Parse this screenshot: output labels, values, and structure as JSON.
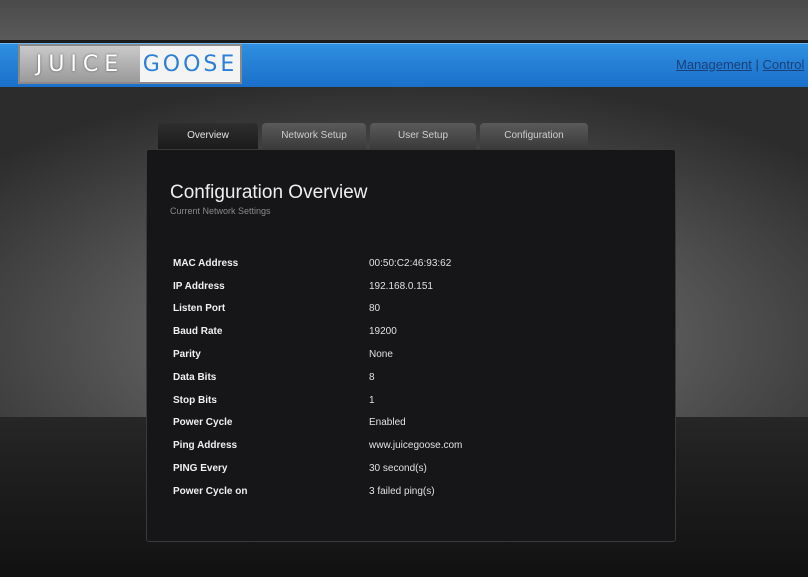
{
  "brand": {
    "juice": "JUICE",
    "goose": "GOOSE"
  },
  "topnav": {
    "management": "Management",
    "separator": " | ",
    "control": "Control"
  },
  "tabs": [
    {
      "label": "Overview",
      "active": true
    },
    {
      "label": "Network Setup",
      "active": false
    },
    {
      "label": "User Setup",
      "active": false
    },
    {
      "label": "Configuration",
      "active": false
    }
  ],
  "page": {
    "title": "Configuration Overview",
    "subtitle": "Current Network Settings"
  },
  "settings": [
    {
      "label": "MAC Address",
      "value": "00:50:C2:46:93:62"
    },
    {
      "label": "IP Address",
      "value": "192.168.0.151"
    },
    {
      "label": "Listen Port",
      "value": "80"
    },
    {
      "label": "Baud Rate",
      "value": "19200"
    },
    {
      "label": "Parity",
      "value": "None"
    },
    {
      "label": "Data Bits",
      "value": "8"
    },
    {
      "label": "Stop Bits",
      "value": "1"
    },
    {
      "label": "Power Cycle",
      "value": "Enabled"
    },
    {
      "label": "Ping Address",
      "value": "www.juicegoose.com"
    },
    {
      "label": "PING Every",
      "value": "30 second(s)"
    },
    {
      "label": "Power Cycle on",
      "value": "3 failed ping(s)"
    }
  ],
  "colors": {
    "accent": "#2a7fd8",
    "panel": "#161618"
  }
}
